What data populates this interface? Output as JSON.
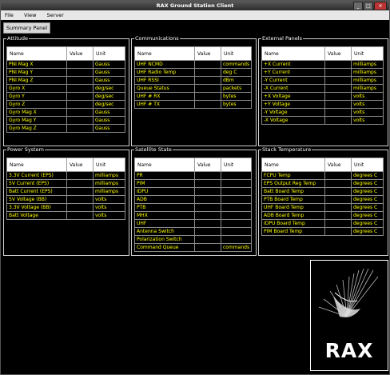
{
  "window": {
    "title": "RAX Ground Station Client"
  },
  "menu": [
    "File",
    "View",
    "Server"
  ],
  "tab": {
    "label": "Summary Panel"
  },
  "columns": [
    "Name",
    "Value",
    "Unit"
  ],
  "panels": [
    {
      "title": "Attitude",
      "rows": [
        {
          "name": "PNI Mag X",
          "value": "",
          "unit": "Gauss"
        },
        {
          "name": "PNI Mag Y",
          "value": "",
          "unit": "Gauss"
        },
        {
          "name": "PNI Mag Z",
          "value": "",
          "unit": "Gauss"
        },
        {
          "name": "Gyro X",
          "value": "",
          "unit": "deg/sec"
        },
        {
          "name": "Gyro Y",
          "value": "",
          "unit": "deg/sec"
        },
        {
          "name": "Gyro Z",
          "value": "",
          "unit": "deg/sec"
        },
        {
          "name": "Gyro Mag X",
          "value": "",
          "unit": "Gauss"
        },
        {
          "name": "Gyro Mag Y",
          "value": "",
          "unit": "Gauss"
        },
        {
          "name": "Gyro Mag Z",
          "value": "",
          "unit": "Gauss"
        }
      ]
    },
    {
      "title": "Communications",
      "rows": [
        {
          "name": "UHF NCMD",
          "value": "",
          "unit": "commands"
        },
        {
          "name": "UHF Radio Temp",
          "value": "",
          "unit": "deg C"
        },
        {
          "name": "UHF RSSI",
          "value": "",
          "unit": "dBm"
        },
        {
          "name": "Queue Status",
          "value": "",
          "unit": "packets"
        },
        {
          "name": "UHF # RX",
          "value": "",
          "unit": "bytes"
        },
        {
          "name": "UHF # TX",
          "value": "",
          "unit": "bytes"
        }
      ]
    },
    {
      "title": "External Panels",
      "rows": [
        {
          "name": "+X Current",
          "value": "",
          "unit": "milliamps"
        },
        {
          "name": "+Y Current",
          "value": "",
          "unit": "milliamps"
        },
        {
          "name": "-Y Current",
          "value": "",
          "unit": "milliamps"
        },
        {
          "name": "-X Current",
          "value": "",
          "unit": "milliamps"
        },
        {
          "name": "+X Voltage",
          "value": "",
          "unit": "volts"
        },
        {
          "name": "+Y Voltage",
          "value": "",
          "unit": "volts"
        },
        {
          "name": "-Y Voltage",
          "value": "",
          "unit": "volts"
        },
        {
          "name": "-X Voltage",
          "value": "",
          "unit": "volts"
        }
      ]
    },
    {
      "title": "Power System",
      "rows": [
        {
          "name": "3.3V Current (EPS)",
          "value": "",
          "unit": "milliamps"
        },
        {
          "name": "5V Current (EPS)",
          "value": "",
          "unit": "milliamps"
        },
        {
          "name": "Batt Current (EPS)",
          "value": "",
          "unit": "milliamps"
        },
        {
          "name": "5V Voltage (BB)",
          "value": "",
          "unit": "volts"
        },
        {
          "name": "3.3V Voltage (BB)",
          "value": "",
          "unit": "volts"
        },
        {
          "name": "Batt Voltage",
          "value": "",
          "unit": "volts"
        }
      ]
    },
    {
      "title": "Satellite State",
      "rows": [
        {
          "name": "PR",
          "value": "",
          "unit": ""
        },
        {
          "name": "PIM",
          "value": "",
          "unit": ""
        },
        {
          "name": "IDPU",
          "value": "",
          "unit": ""
        },
        {
          "name": "ADB",
          "value": "",
          "unit": ""
        },
        {
          "name": "PTB",
          "value": "",
          "unit": ""
        },
        {
          "name": "MHX",
          "value": "",
          "unit": ""
        },
        {
          "name": "UHF",
          "value": "",
          "unit": ""
        },
        {
          "name": "Antenna Switch",
          "value": "",
          "unit": ""
        },
        {
          "name": "Polarization Switch",
          "value": "",
          "unit": ""
        },
        {
          "name": "Command Queue",
          "value": "",
          "unit": "commands"
        }
      ]
    },
    {
      "title": "Stack Temperature",
      "rows": [
        {
          "name": "FCPU Temp",
          "value": "",
          "unit": "degrees C"
        },
        {
          "name": "EPS Output Reg Temp",
          "value": "",
          "unit": "degrees C"
        },
        {
          "name": "Batt Board Temp",
          "value": "",
          "unit": "degrees C"
        },
        {
          "name": "PTB Board Temp",
          "value": "",
          "unit": "degrees C"
        },
        {
          "name": "UHF Board Temp",
          "value": "",
          "unit": "degrees C"
        },
        {
          "name": "ADB Board Temp",
          "value": "",
          "unit": "degrees C"
        },
        {
          "name": "IDPU Board Temp",
          "value": "",
          "unit": "degrees C"
        },
        {
          "name": "PIM Board Temp",
          "value": "",
          "unit": "degrees C"
        }
      ]
    }
  ],
  "logo": {
    "text": "RAX"
  }
}
